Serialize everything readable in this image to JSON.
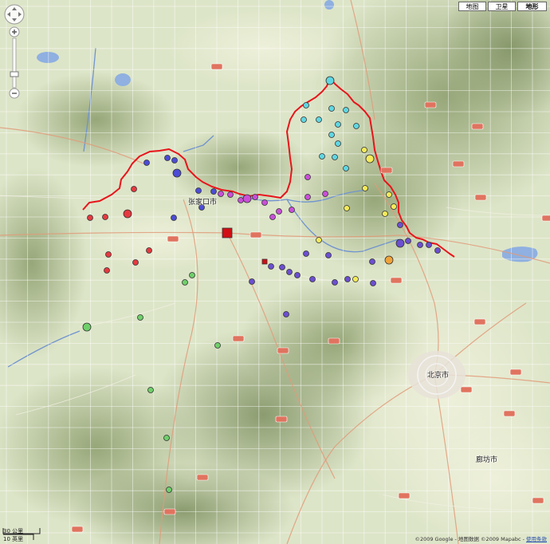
{
  "map_type_buttons": [
    "地图",
    "卫星",
    "地形"
  ],
  "cities": {
    "zhangjiakou": "张家口市",
    "beijing": "北京市",
    "langfang": "廊坊市"
  },
  "scale": {
    "km": "30 公里",
    "mi": "10 英里"
  },
  "copyright": {
    "text": "©2009 Google - 地图数据 ©2009 Mapabc - ",
    "link": "使用条款"
  },
  "colors": {
    "boundary": "#e8141b",
    "red": "#e53940",
    "blue": "#4c4cd6",
    "magenta": "#c94fd8",
    "cyan": "#5fd6e2",
    "yellow": "#f4ea5a",
    "purple": "#6c4fd0",
    "green": "#6fcf6a",
    "orange": "#f0a33a"
  },
  "icons": [
    "pan-control-icon",
    "zoom-in-icon",
    "zoom-out-icon",
    "zoom-slider-icon"
  ]
}
